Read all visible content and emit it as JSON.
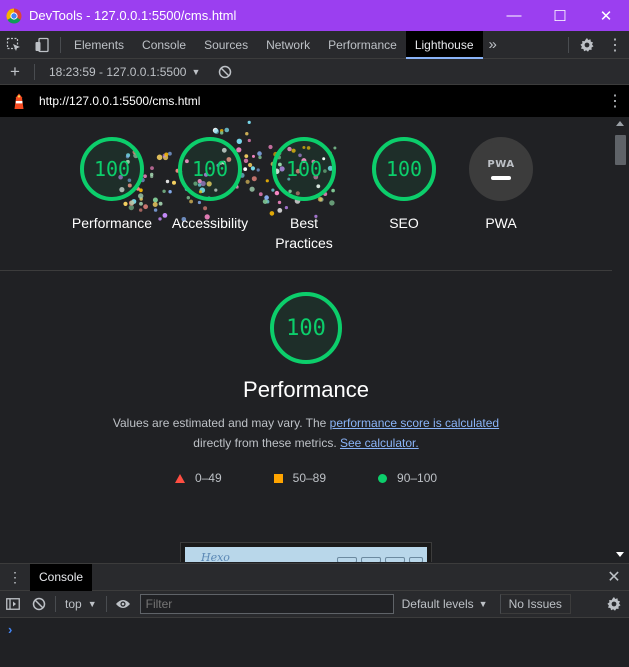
{
  "window": {
    "title": "DevTools - 127.0.0.1:5500/cms.html",
    "minimize_glyph": "—",
    "maximize_glyph": "☐",
    "close_glyph": "✕"
  },
  "tabs": {
    "items": [
      {
        "label": "Elements"
      },
      {
        "label": "Console"
      },
      {
        "label": "Sources"
      },
      {
        "label": "Network"
      },
      {
        "label": "Performance"
      },
      {
        "label": "Lighthouse",
        "active": true
      }
    ],
    "more_glyph": "»"
  },
  "reportbar": {
    "plus_glyph": "+",
    "session": "18:23:59 - 127.0.0.1:5500",
    "caret": "▼"
  },
  "urlbar": {
    "url": "http://127.0.0.1:5500/cms.html",
    "kebab": "⋮"
  },
  "scores": [
    {
      "label": "Performance",
      "value": "100"
    },
    {
      "label": "Accessibility",
      "value": "100"
    },
    {
      "label": "Best Practices",
      "value": "100"
    },
    {
      "label": "SEO",
      "value": "100"
    },
    {
      "label": "PWA",
      "badge": "PWA"
    }
  ],
  "performance": {
    "score": "100",
    "title": "Performance",
    "desc_text_1": "Values are estimated and may vary. The ",
    "desc_link_1": "performance score is calculated",
    "desc_text_2": "directly from these metrics. ",
    "desc_link_2": "See calculator."
  },
  "legend": [
    {
      "range": "0–49",
      "shape": "triangle",
      "color": "#ff4e42"
    },
    {
      "range": "50–89",
      "shape": "square",
      "color": "#ffa400"
    },
    {
      "range": "90–100",
      "shape": "circle",
      "color": "#0cce6b"
    }
  ],
  "thumbnail": {
    "logo_text": "Hexo"
  },
  "drawer": {
    "kebab": "⋮",
    "tab": "Console",
    "close": "✕"
  },
  "console": {
    "context": "top",
    "caret": "▼",
    "filter_placeholder": "Filter",
    "levels": "Default levels",
    "issues": "No Issues",
    "prompt": "›"
  },
  "colors": {
    "title_bar": "#9b3ff0",
    "pass_green": "#0cce6b",
    "link_blue": "#8ab4f8"
  }
}
